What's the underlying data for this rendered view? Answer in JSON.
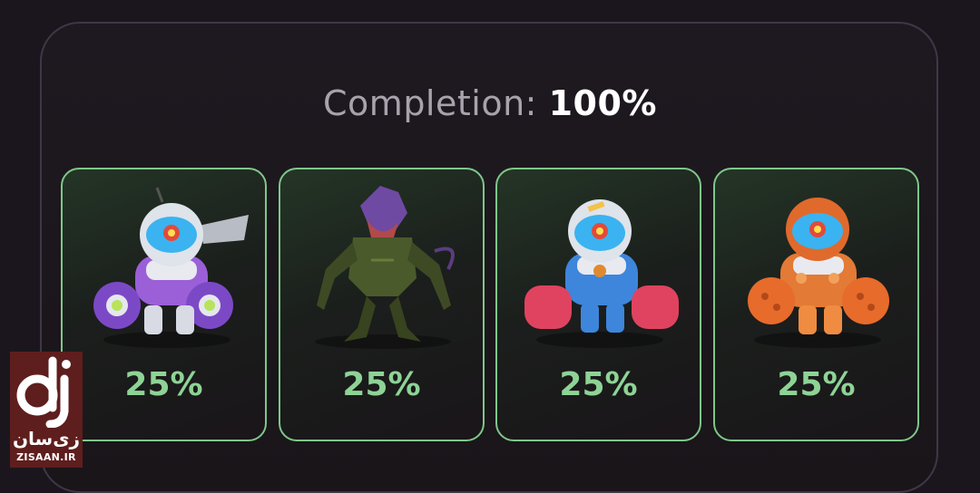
{
  "completion": {
    "label": "Completion:",
    "value": "100%"
  },
  "cards": [
    {
      "percent": "25%",
      "icon": "purple-astronaut-robot-icon",
      "accent": "#9a6ee0"
    },
    {
      "percent": "25%",
      "icon": "alien-creature-icon",
      "accent": "#6b8a3a"
    },
    {
      "percent": "25%",
      "icon": "blue-astronaut-robot-icon",
      "accent": "#3f8ee0"
    },
    {
      "percent": "25%",
      "icon": "orange-astronaut-robot-icon",
      "accent": "#e07a35"
    }
  ],
  "watermark": {
    "name_fa": "زی‌سان",
    "name_en": "ZISAAN.IR"
  },
  "colors": {
    "card_border": "#7ec78a",
    "percent_text": "#8ed396",
    "background": "#1b161d"
  }
}
